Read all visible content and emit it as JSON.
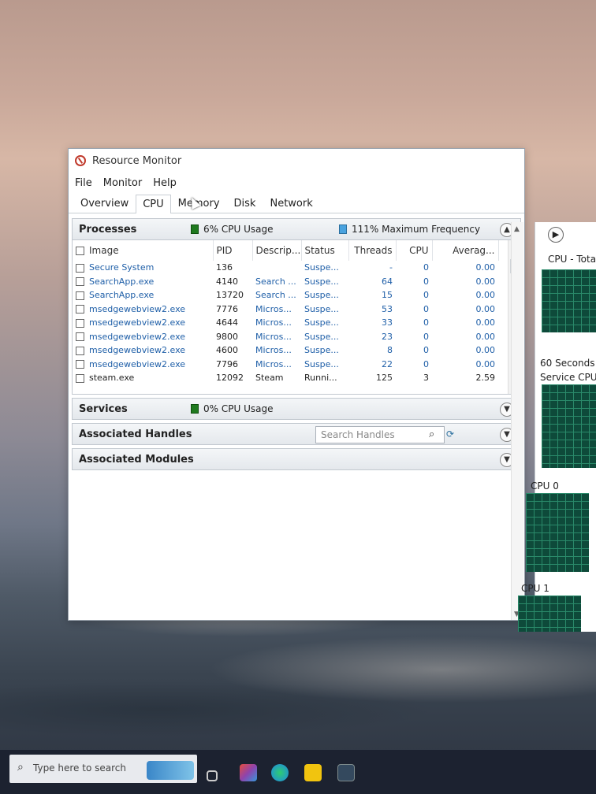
{
  "window": {
    "title": "Resource Monitor",
    "menu": [
      "File",
      "Monitor",
      "Help"
    ],
    "tabs": [
      {
        "label": "Overview",
        "active": false
      },
      {
        "label": "CPU",
        "active": true
      },
      {
        "label": "Memory",
        "active": false
      },
      {
        "label": "Disk",
        "active": false
      },
      {
        "label": "Network",
        "active": false
      }
    ]
  },
  "processes": {
    "header": "Processes",
    "cpu_usage": "6% CPU Usage",
    "max_frequency": "111% Maximum Frequency",
    "columns": [
      "Image",
      "PID",
      "Descrip...",
      "Status",
      "Threads",
      "CPU",
      "Averag..."
    ],
    "rows": [
      {
        "image": "Secure System",
        "pid": "136",
        "desc": "",
        "status": "Suspe...",
        "threads": "-",
        "cpu": "0",
        "avg": "0.00"
      },
      {
        "image": "SearchApp.exe",
        "pid": "4140",
        "desc": "Search ...",
        "status": "Suspe...",
        "threads": "64",
        "cpu": "0",
        "avg": "0.00"
      },
      {
        "image": "SearchApp.exe",
        "pid": "13720",
        "desc": "Search ...",
        "status": "Suspe...",
        "threads": "15",
        "cpu": "0",
        "avg": "0.00"
      },
      {
        "image": "msedgewebview2.exe",
        "pid": "7776",
        "desc": "Micros...",
        "status": "Suspe...",
        "threads": "53",
        "cpu": "0",
        "avg": "0.00"
      },
      {
        "image": "msedgewebview2.exe",
        "pid": "4644",
        "desc": "Micros...",
        "status": "Suspe...",
        "threads": "33",
        "cpu": "0",
        "avg": "0.00"
      },
      {
        "image": "msedgewebview2.exe",
        "pid": "9800",
        "desc": "Micros...",
        "status": "Suspe...",
        "threads": "23",
        "cpu": "0",
        "avg": "0.00"
      },
      {
        "image": "msedgewebview2.exe",
        "pid": "4600",
        "desc": "Micros...",
        "status": "Suspe...",
        "threads": "8",
        "cpu": "0",
        "avg": "0.00"
      },
      {
        "image": "msedgewebview2.exe",
        "pid": "7796",
        "desc": "Micros...",
        "status": "Suspe...",
        "threads": "22",
        "cpu": "0",
        "avg": "0.00"
      },
      {
        "image": "steam.exe",
        "pid": "12092",
        "desc": "Steam",
        "status": "Runni...",
        "threads": "125",
        "cpu": "3",
        "avg": "2.59"
      }
    ]
  },
  "services": {
    "header": "Services",
    "cpu_usage": "0% CPU Usage"
  },
  "handles": {
    "header": "Associated Handles",
    "search_placeholder": "Search Handles"
  },
  "modules": {
    "header": "Associated Modules"
  },
  "right_panel": {
    "cpu_total_label": "CPU - Tota",
    "seconds_label": "60 Seconds",
    "service_cpu_label": "Service CPU",
    "cpu0_label": "CPU 0",
    "cpu1_label": "CPU 1"
  },
  "taskbar": {
    "search_placeholder": "Type here to search"
  },
  "icons": {
    "app": "resource-monitor-icon",
    "collapse": "chevron-up-icon",
    "expand": "chevron-down-icon",
    "search": "search-icon",
    "refresh": "refresh-icon",
    "panel_toggle": "chevron-right-icon"
  }
}
